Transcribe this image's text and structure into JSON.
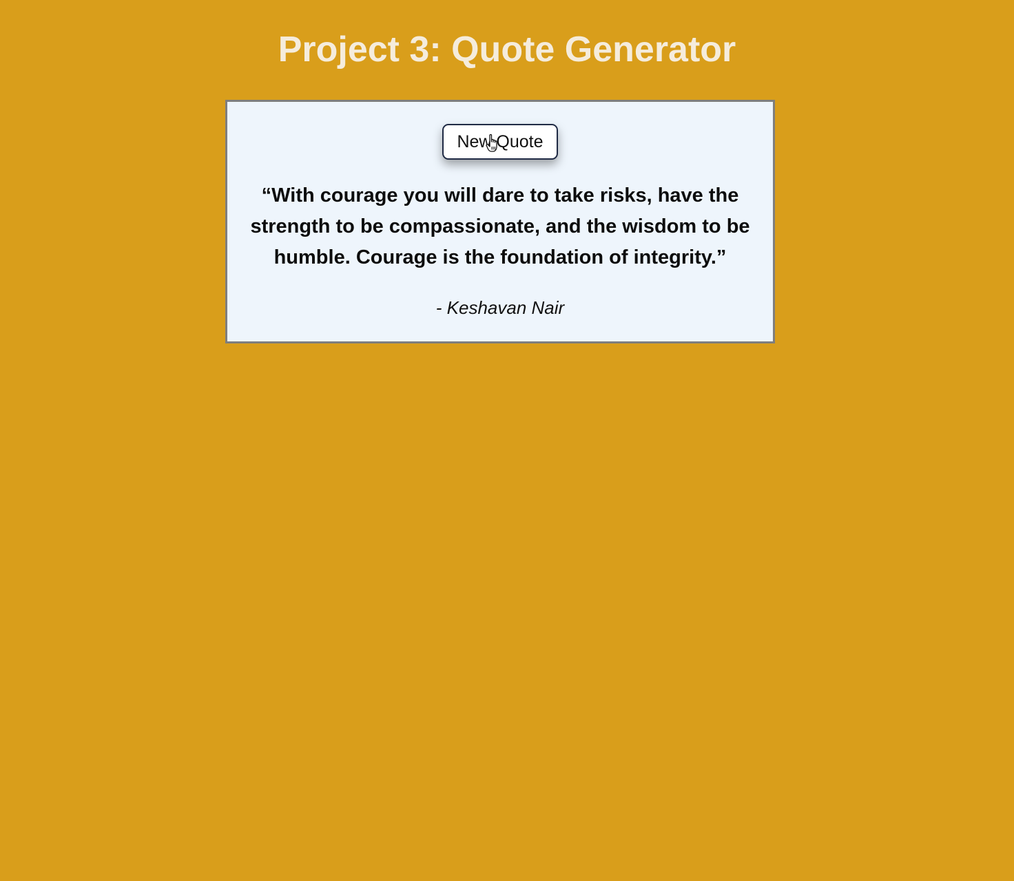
{
  "header": {
    "title": "Project 3: Quote Generator"
  },
  "quote_card": {
    "button_label": "New Quote",
    "quote": "“With courage you will dare to take risks, have the strength to be compassionate, and the wisdom to be humble. Courage is the foundation of integrity.”",
    "author": "- Keshavan Nair",
    "cursor_icon": "hand-pointer-icon"
  },
  "colors": {
    "background": "#d99e1b",
    "title": "#f5ecdc",
    "card_background": "#eef5fc",
    "card_border": "#7e7e7e"
  }
}
